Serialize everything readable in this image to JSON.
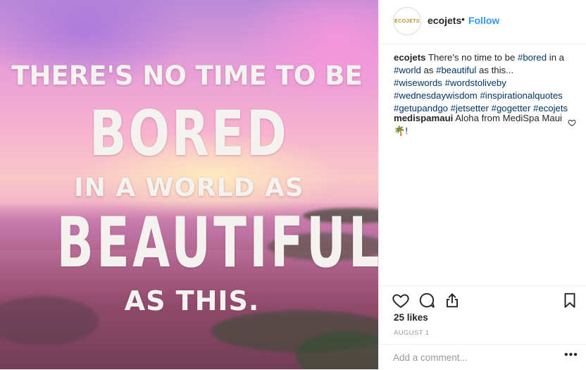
{
  "image": {
    "quote_lines": [
      "THERE'S NO TIME TO BE",
      "BORED",
      "IN A WORLD AS",
      "BEAUTIFUL",
      "AS THIS."
    ]
  },
  "header": {
    "avatar_text": "ECOJETS",
    "username": "ecojets",
    "separator": "•",
    "follow_label": "Follow"
  },
  "caption": {
    "username": "ecojets",
    "text_1": " There's no time to be ",
    "tag_bored": "#bored",
    "text_2": " in a ",
    "tag_world": "#world",
    "text_3": " as ",
    "tag_beautiful": "#beautiful",
    "text_4": " as this...",
    "tag_wisewords": "#wisewords",
    "tag_wordstoliveby": "#wordstoliveby",
    "tag_wednesdaywisdom": "#wednesdaywisdom",
    "tag_inspirationalquotes": "#inspirationalquotes",
    "tag_getupandgo": "#getupandgo",
    "tag_jetsetter": "#jetsetter",
    "tag_gogetter": "#gogetter",
    "tag_ecojets": "#ecojets"
  },
  "comments": [
    {
      "username": "medispamaui",
      "text": " Aloha from MediSpa Maui",
      "emoji": "🌴",
      "suffix": "!"
    }
  ],
  "actions": {
    "like_icon": "heart-icon",
    "comment_icon": "comment-icon",
    "share_icon": "share-icon",
    "save_icon": "bookmark-icon"
  },
  "likes_text": "25 likes",
  "date_text": "AUGUST 1",
  "add_comment": {
    "placeholder": "Add a comment...",
    "more_label": "•••"
  },
  "colors": {
    "link": "#003569",
    "follow": "#3897f0",
    "text": "#262626",
    "muted": "#999999"
  }
}
